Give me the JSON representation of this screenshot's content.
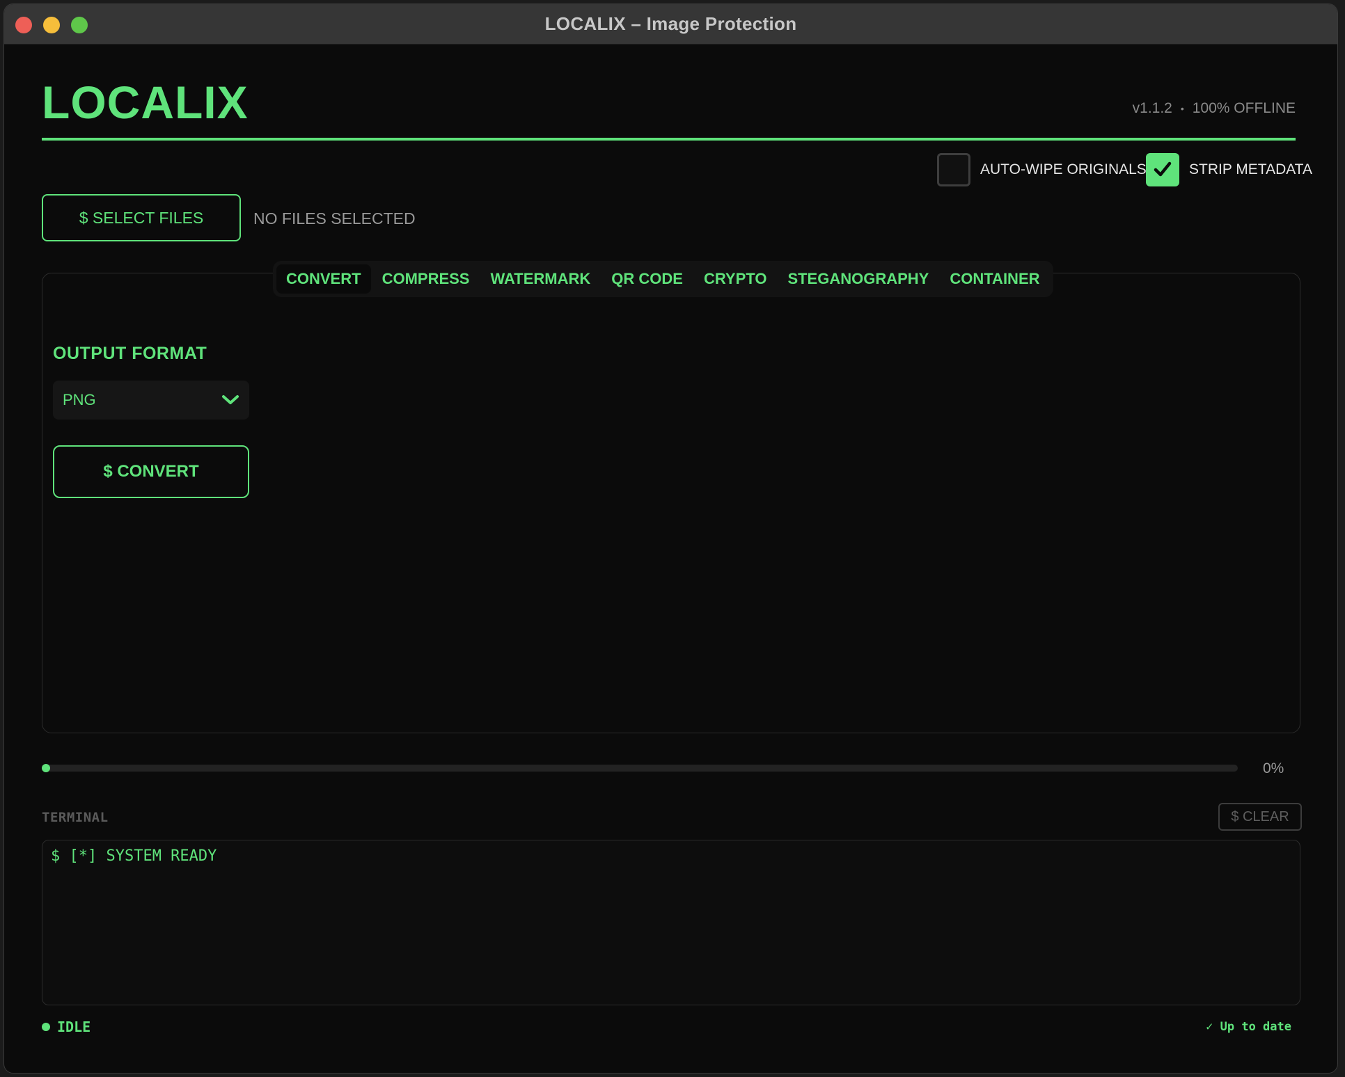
{
  "window": {
    "title": "LOCALIX – Image Protection"
  },
  "header": {
    "logo": "LOCALIX",
    "version": "v1.1.2",
    "separator": "•",
    "mode": "100% OFFLINE"
  },
  "options": {
    "auto_wipe": {
      "label": "AUTO-WIPE ORIGINALS",
      "checked": false
    },
    "strip_metadata": {
      "label": "STRIP METADATA",
      "checked": true
    }
  },
  "files": {
    "select_label": "$ SELECT FILES",
    "status": "NO FILES SELECTED"
  },
  "tabs": [
    {
      "label": "CONVERT",
      "active": true
    },
    {
      "label": "COMPRESS"
    },
    {
      "label": "WATERMARK"
    },
    {
      "label": "QR CODE"
    },
    {
      "label": "CRYPTO"
    },
    {
      "label": "STEGANOGRAPHY"
    },
    {
      "label": "CONTAINER"
    }
  ],
  "convert": {
    "output_format_label": "OUTPUT FORMAT",
    "format_value": "PNG",
    "convert_label": "$ CONVERT"
  },
  "progress": {
    "value": 0,
    "label": "0%"
  },
  "terminal": {
    "label": "TERMINAL",
    "clear_label": "$ CLEAR",
    "lines": [
      "$ [*] SYSTEM READY"
    ]
  },
  "status": {
    "state": "IDLE",
    "update": "✓ Up to date"
  },
  "colors": {
    "accent": "#5fe37b",
    "background": "#0b0b0b"
  }
}
